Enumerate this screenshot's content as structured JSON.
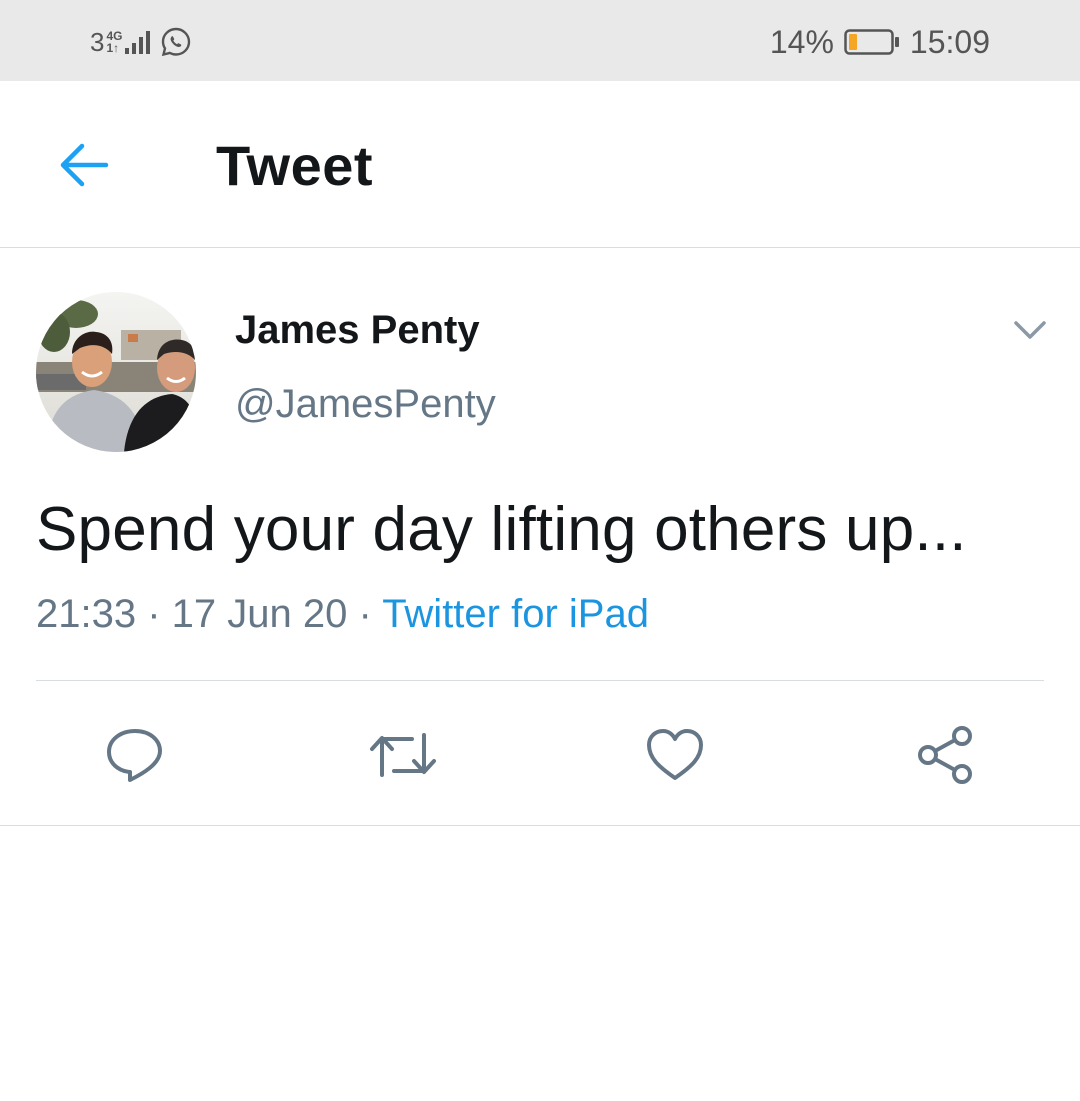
{
  "status_bar": {
    "sim": "3",
    "network": "4G",
    "network_sub": "1↑",
    "battery_percent": "14%",
    "time": "15:09"
  },
  "header": {
    "title": "Tweet"
  },
  "tweet": {
    "author_name": "James Penty",
    "author_handle": "@JamesPenty",
    "text": "Spend your day lifting others up...",
    "time": "21:33",
    "separator": " · ",
    "date": "17 Jun 20",
    "source": "Twitter for iPad"
  },
  "icons": {
    "back": "arrow-left-icon",
    "more": "chevron-down-icon",
    "reply": "reply-icon",
    "retweet": "retweet-icon",
    "like": "heart-icon",
    "share": "share-icon"
  },
  "colors": {
    "accent": "#1da1f2",
    "text_primary": "#14171a",
    "text_secondary": "#657786",
    "link": "#1b95e0",
    "status_bar_bg": "#e9e9e9",
    "battery_low": "#f5a623"
  }
}
